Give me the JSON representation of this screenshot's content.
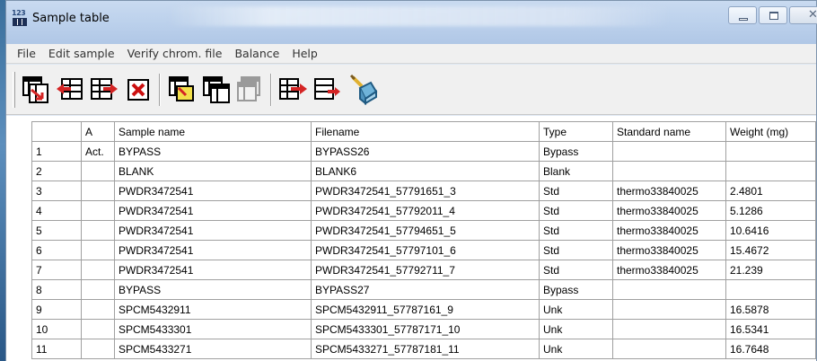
{
  "window": {
    "title": "Sample table",
    "icon_digits": "123"
  },
  "menu": [
    "File",
    "Edit sample",
    "Verify chrom. file",
    "Balance",
    "Help"
  ],
  "toolbar": {
    "icons": [
      "table-arrow-icon",
      "insert-left-icon",
      "insert-right-icon",
      "delete-icon",
      "table-highlight-icon",
      "table-copy-disabled-icon",
      "move-right-icon",
      "move-out-icon",
      "verify-vial-icon"
    ],
    "colors": {
      "arrow_red": "#d42424",
      "delete_red": "#cc1010",
      "highlight_yellow": "#f3e04a"
    }
  },
  "table": {
    "columns": [
      "",
      "A",
      "Sample name",
      "Filename",
      "Type",
      "Standard name",
      "Weight (mg)"
    ],
    "rows": [
      [
        "1",
        "Act.",
        "BYPASS",
        "BYPASS26",
        "Bypass",
        "",
        ""
      ],
      [
        "2",
        "",
        "BLANK",
        "BLANK6",
        "Blank",
        "",
        ""
      ],
      [
        "3",
        "",
        "PWDR3472541",
        "PWDR3472541_57791651_3",
        "Std",
        "thermo33840025",
        "2.4801"
      ],
      [
        "4",
        "",
        "PWDR3472541",
        "PWDR3472541_57792011_4",
        "Std",
        "thermo33840025",
        "5.1286"
      ],
      [
        "5",
        "",
        "PWDR3472541",
        "PWDR3472541_57794651_5",
        "Std",
        "thermo33840025",
        "10.6416"
      ],
      [
        "6",
        "",
        "PWDR3472541",
        "PWDR3472541_57797101_6",
        "Std",
        "thermo33840025",
        "15.4672"
      ],
      [
        "7",
        "",
        "PWDR3472541",
        "PWDR3472541_57792711_7",
        "Std",
        "thermo33840025",
        "21.239"
      ],
      [
        "8",
        "",
        "BYPASS",
        "BYPASS27",
        "Bypass",
        "",
        ""
      ],
      [
        "9",
        "",
        "SPCM5432911",
        "SPCM5432911_57787161_9",
        "Unk",
        "",
        "16.5878"
      ],
      [
        "10",
        "",
        "SPCM5433301",
        "SPCM5433301_57787171_10",
        "Unk",
        "",
        "16.5341"
      ],
      [
        "11",
        "",
        "SPCM5433271",
        "SPCM5433271_57787181_11",
        "Unk",
        "",
        "16.7648"
      ]
    ]
  }
}
